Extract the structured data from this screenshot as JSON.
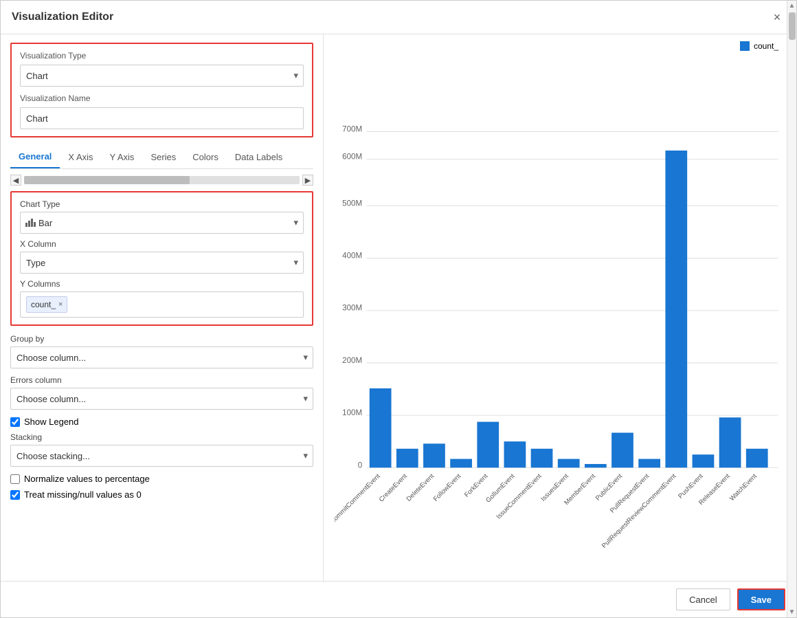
{
  "dialog": {
    "title": "Visualization Editor",
    "close_label": "×"
  },
  "left": {
    "viz_type_label": "Visualization Type",
    "viz_type_value": "Chart",
    "viz_name_label": "Visualization Name",
    "viz_name_value": "Chart",
    "tabs": [
      {
        "label": "General",
        "active": true
      },
      {
        "label": "X Axis"
      },
      {
        "label": "Y Axis"
      },
      {
        "label": "Series"
      },
      {
        "label": "Colors"
      },
      {
        "label": "Data Labels"
      }
    ],
    "chart_type_label": "Chart Type",
    "chart_type_value": "Bar",
    "x_column_label": "X Column",
    "x_column_value": "Type",
    "y_columns_label": "Y Columns",
    "y_column_tag": "count_",
    "group_by_label": "Group by",
    "group_by_placeholder": "Choose column...",
    "errors_column_label": "Errors column",
    "errors_column_placeholder": "Choose column...",
    "show_legend_label": "Show Legend",
    "show_legend_checked": true,
    "stacking_label": "Stacking",
    "stacking_placeholder": "Choose stacking...",
    "normalize_label": "Normalize values to percentage",
    "normalize_checked": false,
    "treat_null_label": "Treat missing/null values as 0",
    "treat_null_checked": true
  },
  "chart": {
    "legend_label": "count_",
    "y_axis_labels": [
      "0",
      "100M",
      "200M",
      "300M",
      "400M",
      "500M",
      "600M",
      "700M"
    ],
    "bars": [
      {
        "label": "CommitCommentEvent",
        "value": 165
      },
      {
        "label": "CreateEvent",
        "value": 40
      },
      {
        "label": "DeleteEvent",
        "value": 50
      },
      {
        "label": "FollowEvent",
        "value": 18
      },
      {
        "label": "ForkEvent",
        "value": 95
      },
      {
        "label": "GollumEvent",
        "value": 55
      },
      {
        "label": "IssueCommentEvent",
        "value": 40
      },
      {
        "label": "IssuesEvent",
        "value": 18
      },
      {
        "label": "MemberEvent",
        "value": 8
      },
      {
        "label": "PublicEvent",
        "value": 72
      },
      {
        "label": "PullRequestEvent",
        "value": 18
      },
      {
        "label": "PullRequestReviewCommentEvent",
        "value": 660
      },
      {
        "label": "PushEvent",
        "value": 28
      },
      {
        "label": "ReleaseEvent",
        "value": 105
      },
      {
        "label": "WatchEvent",
        "value": 40
      }
    ]
  },
  "footer": {
    "cancel_label": "Cancel",
    "save_label": "Save"
  }
}
